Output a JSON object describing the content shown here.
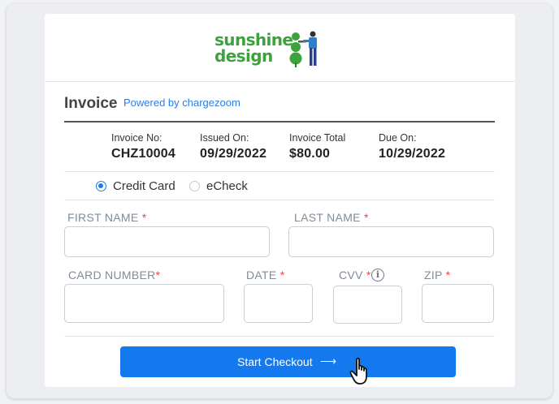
{
  "brand": {
    "line1": "sunshine",
    "line2": "design",
    "color": "#3ba33b"
  },
  "invoice": {
    "title": "Invoice",
    "powered_by": "Powered by chargezoom",
    "fields": [
      {
        "label": "Invoice No:",
        "value": "CHZ10004"
      },
      {
        "label": "Issued On:",
        "value": "09/29/2022"
      },
      {
        "label": "Invoice Total",
        "value": "$80.00"
      },
      {
        "label": "Due On:",
        "value": "10/29/2022"
      }
    ]
  },
  "payment_methods": [
    {
      "label": "Credit Card",
      "selected": true
    },
    {
      "label": "eCheck",
      "selected": false
    }
  ],
  "form": {
    "first_name": "FIRST NAME",
    "last_name": "LAST NAME",
    "card_number": "CARD NUMBER",
    "date": "DATE",
    "cvv": "CVV",
    "zip": "ZIP",
    "required_mark": "*",
    "info_glyph": "i"
  },
  "checkout_button": {
    "label": "Start Checkout",
    "arrow": "⟶"
  },
  "colors": {
    "accent": "#1479ee",
    "required": "#e04a4a",
    "label": "#7f8c99"
  }
}
